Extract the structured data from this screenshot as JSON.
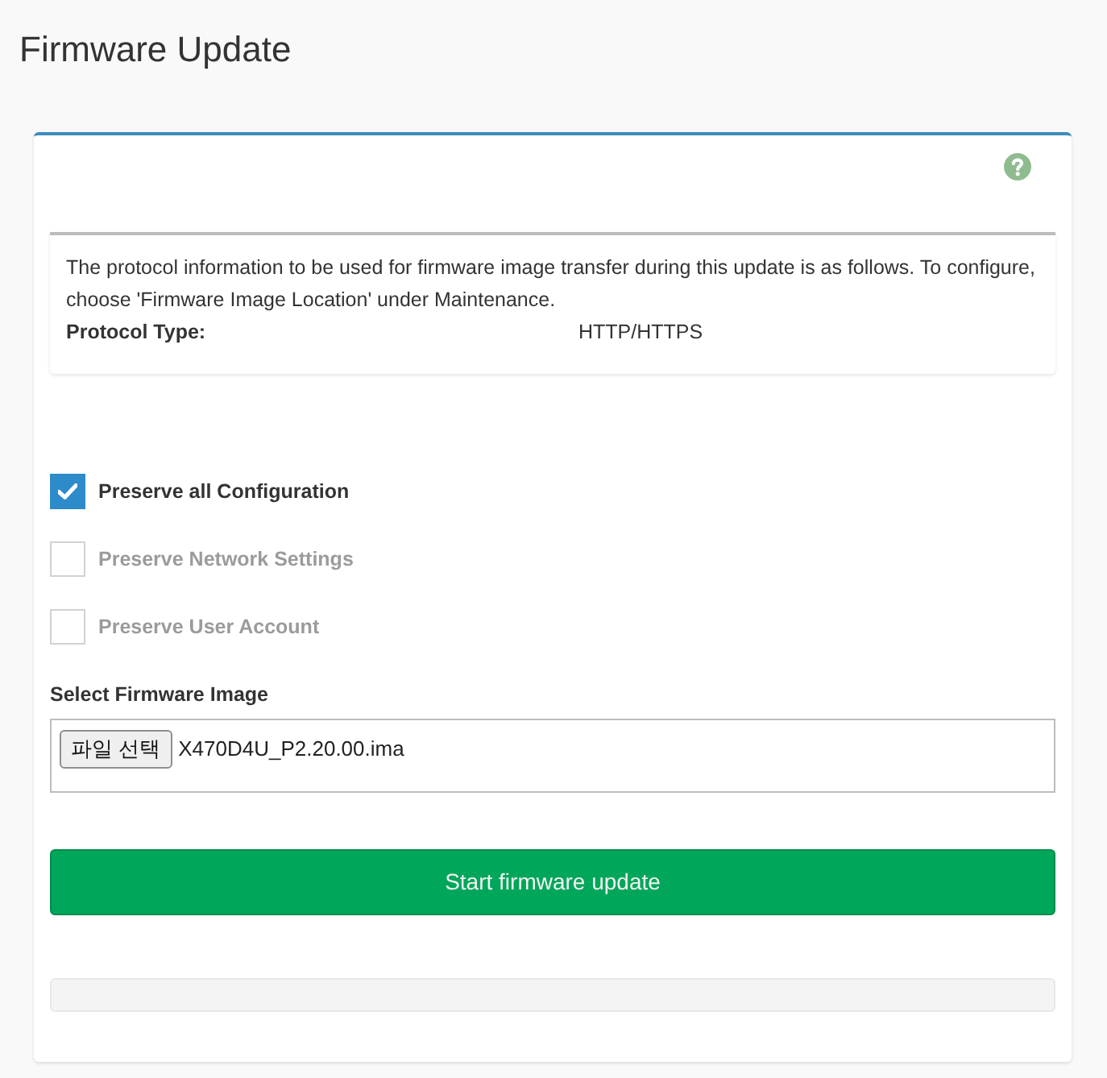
{
  "page": {
    "title": "Firmware Update"
  },
  "info": {
    "text": "The protocol information to be used for firmware image transfer during this update is as follows. To configure, choose 'Firmware Image Location' under Maintenance.",
    "protocol_label": "Protocol Type:",
    "protocol_value": "HTTP/HTTPS"
  },
  "options": [
    {
      "label": "Preserve all Configuration",
      "checked": true,
      "disabled": false
    },
    {
      "label": "Preserve Network Settings",
      "checked": false,
      "disabled": true
    },
    {
      "label": "Preserve User Account",
      "checked": false,
      "disabled": true
    }
  ],
  "firmware_image": {
    "label": "Select Firmware Image",
    "button": "파일 선택",
    "file_name": "X470D4U_P2.20.00.ima"
  },
  "start_button": {
    "label": "Start firmware update"
  }
}
